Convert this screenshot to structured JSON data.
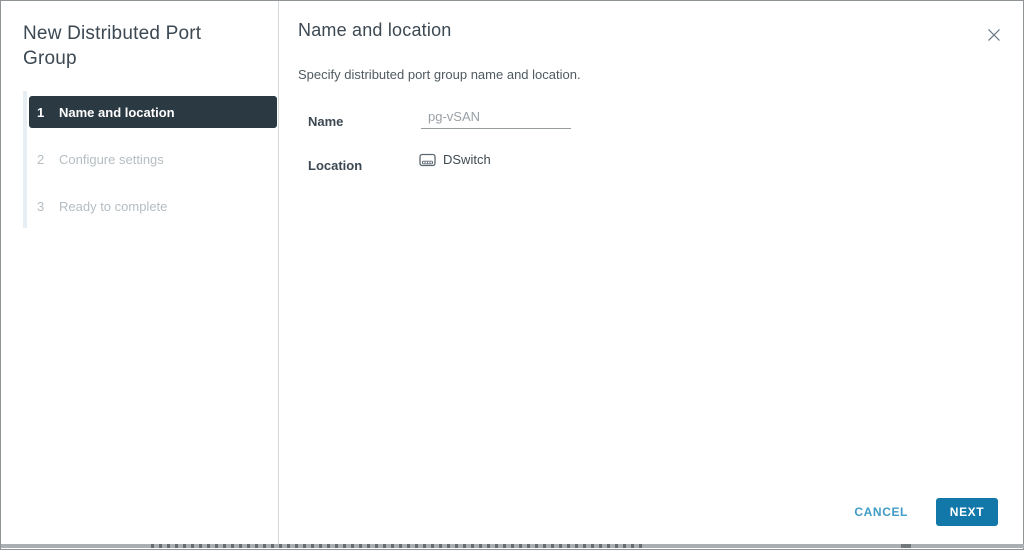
{
  "window": {
    "title": "New Distributed Port Group"
  },
  "sidebar": {
    "steps": [
      {
        "number": "1",
        "label": "Name and location"
      },
      {
        "number": "2",
        "label": "Configure settings"
      },
      {
        "number": "3",
        "label": "Ready to complete"
      }
    ],
    "active_step": 1
  },
  "main": {
    "heading": "Name and location",
    "description": "Specify distributed port group name and location.",
    "name_field": {
      "label": "Name",
      "value": "pg-vSAN"
    },
    "location_field": {
      "label": "Location",
      "value": "DSwitch",
      "icon": "dswitch-icon"
    }
  },
  "footer": {
    "cancel_label": "CANCEL",
    "next_label": "NEXT"
  },
  "colors": {
    "primary_button_blue": "#1277a9",
    "link_blue": "#3f9cc6",
    "active_step_bg": "#2b3a42",
    "heading_text": "#3c4852",
    "inactive_step_text": "#b5bdc2"
  }
}
